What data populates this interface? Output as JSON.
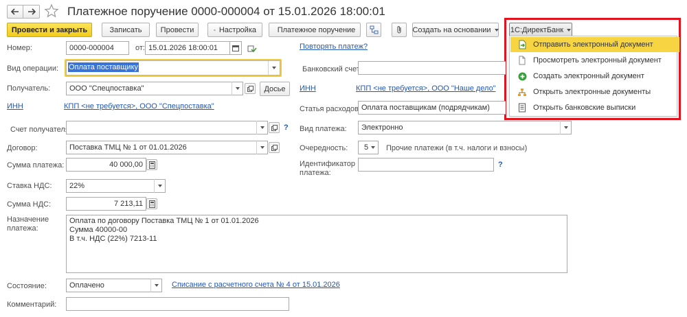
{
  "title": "Платежное поручение 0000-000004 от 15.01.2026 18:00:01",
  "toolbar": {
    "post_close": "Провести и закрыть",
    "save": "Записать",
    "post": "Провести",
    "settings": "Настройка",
    "payment_order": "Платежное поручение",
    "create_based_on": "Создать на основании",
    "directbank": "1С:ДиректБанк"
  },
  "directbank_menu": [
    {
      "label": "Отправить электронный документ",
      "icon": "send-document-icon",
      "active": true
    },
    {
      "label": "Просмотреть электронный документ",
      "icon": "document-icon",
      "active": false
    },
    {
      "label": "Создать электронный документ",
      "icon": "plus-circle-icon",
      "active": false
    },
    {
      "label": "Открыть электронные документы",
      "icon": "documents-tree-icon",
      "active": false
    },
    {
      "label": "Открыть банковские выписки",
      "icon": "statement-icon",
      "active": false
    }
  ],
  "form": {
    "number_label": "Номер:",
    "number_value": "0000-000004",
    "date_from_label": "от:",
    "date_value": "15.01.2026 18:00:01",
    "repeat_payment_link": "Повторять платеж?",
    "operation_label": "Вид операции:",
    "operation_value": "Оплата поставщику",
    "bank_account_label": "Банковский счет:",
    "bank_account_value": "",
    "recipient_label": "Получатель:",
    "recipient_value": "ООО \"Спецпоставка\"",
    "dossier_button": "Досье",
    "payer_inn": "ИНН",
    "payer_kpp": "КПП <не требуется>, ООО \"Наше дело\"",
    "recipient_inn": "ИНН",
    "recipient_kpp": "КПП <не требуется>, ООО \"Спецпоставка\"",
    "expense_item_label": "Статья расходов:",
    "expense_item_value": "Оплата поставщикам (подрядчикам)",
    "recipient_account_label": "Счет получателя:",
    "recipient_account_value": "",
    "payment_type_label": "Вид платежа:",
    "payment_type_value": "Электронно",
    "contract_label": "Договор:",
    "contract_value": "Поставка ТМЦ № 1 от 01.01.2026",
    "priority_label": "Очередность:",
    "priority_value": "5",
    "priority_hint": "Прочие платежи (в т.ч. налоги и взносы)",
    "amount_label": "Сумма платежа:",
    "amount_value": "40 000,00",
    "payment_id_label": "Идентификатор платежа:",
    "payment_id_value": "",
    "vat_rate_label": "Ставка НДС:",
    "vat_rate_value": "22%",
    "vat_amount_label": "Сумма НДС:",
    "vat_amount_value": "7 213,11",
    "purpose_label": "Назначение платежа:",
    "purpose_value": "Оплата по договору Поставка ТМЦ № 1 от 01.01.2026\nСумма 40000-00\nВ т.ч. НДС  (22%) 7213-11",
    "status_label": "Состояние:",
    "status_value": "Оплачено",
    "writeoff_link": "Списание с расчетного счета № 4 от 15.01.2026",
    "comment_label": "Комментарий:",
    "comment_value": "",
    "help_mark": "?"
  },
  "colors": {
    "accent_yellow": "#f7d442",
    "link_blue": "#2156b8",
    "highlight_red": "#e2131d",
    "selection_blue": "#3a73d6"
  }
}
